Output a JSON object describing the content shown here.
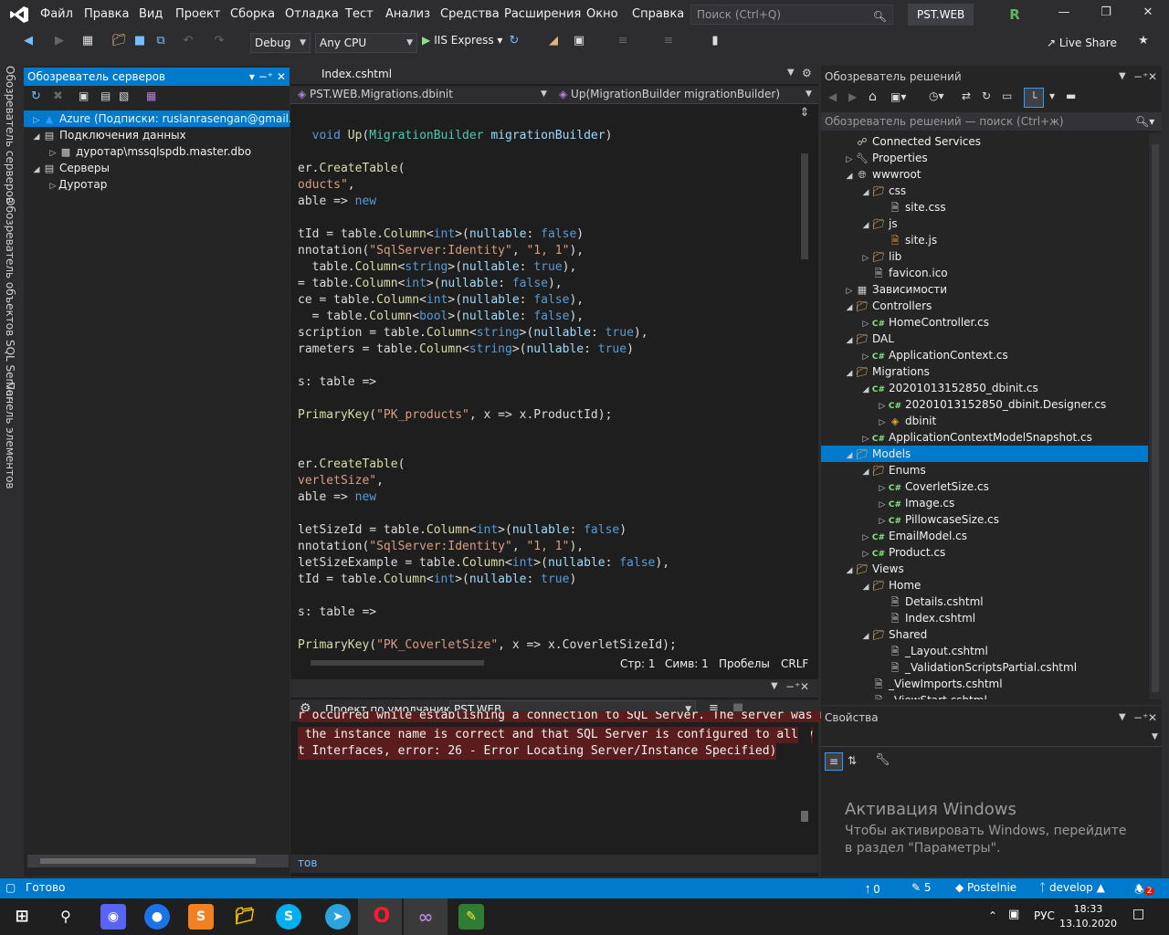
{
  "menu": [
    "Файл",
    "Правка",
    "Вид",
    "Проект",
    "Сборка",
    "Отладка",
    "Тест",
    "Анализ",
    "Средства",
    "Расширения",
    "Окно",
    "Справка"
  ],
  "search_placeholder": "Поиск (Ctrl+Q)",
  "solution_name": "PST.WEB",
  "avatar_letter": "R",
  "toolbar": {
    "config": "Debug",
    "platform": "Any CPU",
    "run_label": "IIS Express",
    "live_share": "Live Share"
  },
  "left_tabs": [
    "Обозреватель серверов",
    "Обозреватель объектов SQL Server",
    "Панель элементов"
  ],
  "server_explorer": {
    "title": "Обозреватель серверов",
    "items": [
      {
        "label": "Azure (Подписки: ruslanrasengan@gmail.com",
        "indent": 0,
        "icon": "azure-icon",
        "exp": "collapsed",
        "selected": true
      },
      {
        "label": "Подключения данных",
        "indent": 0,
        "icon": "database-icon",
        "exp": "expanded"
      },
      {
        "label": "дуротар\\mssqlspdb.master.dbo",
        "indent": 1,
        "icon": "db-connection-icon",
        "exp": "collapsed"
      },
      {
        "label": "Серверы",
        "indent": 0,
        "icon": "server-icon",
        "exp": "expanded"
      },
      {
        "label": "Дуротар",
        "indent": 1,
        "icon": "",
        "exp": "collapsed"
      }
    ]
  },
  "editor": {
    "tab": "Index.cshtml",
    "nav_left": "PST.WEB.Migrations.dbinit",
    "nav_right": "Up(MigrationBuilder migrationBuilder)",
    "status": {
      "line": "Стр: 1",
      "col": "Симв: 1",
      "spaces": "Пробелы",
      "eol": "CRLF"
    }
  },
  "output": {
    "project_label": "Проект по умолчанию:",
    "project": "PST.WEB",
    "errors": [
      "r occurred while establishing a connection to SQL Server. The server was not",
      " the instance name is correct and that SQL Server is configured to allow",
      "t Interfaces, error: 26 - Error Locating Server/Instance Specified)"
    ],
    "bottom_tab": "тов"
  },
  "solution_explorer": {
    "title": "Обозреватель решений",
    "search": "Обозреватель решений — поиск (Ctrl+ж)",
    "items": [
      {
        "label": "Connected Services",
        "indent": 0,
        "icon": "connected-services-icon",
        "exp": "none"
      },
      {
        "label": "Properties",
        "indent": 0,
        "icon": "wrench-icon",
        "exp": "collapsed"
      },
      {
        "label": "wwwroot",
        "indent": 0,
        "icon": "globe-icon",
        "exp": "expanded"
      },
      {
        "label": "css",
        "indent": 1,
        "icon": "folder-icon",
        "exp": "expanded"
      },
      {
        "label": "site.css",
        "indent": 2,
        "icon": "file-icon",
        "exp": "none"
      },
      {
        "label": "js",
        "indent": 1,
        "icon": "folder-icon",
        "exp": "expanded"
      },
      {
        "label": "site.js",
        "indent": 2,
        "icon": "js-file-icon",
        "exp": "none"
      },
      {
        "label": "lib",
        "indent": 1,
        "icon": "folder-icon",
        "exp": "collapsed"
      },
      {
        "label": "favicon.ico",
        "indent": 1,
        "icon": "file-icon",
        "exp": "none"
      },
      {
        "label": "Зависимости",
        "indent": 0,
        "icon": "dependencies-icon",
        "exp": "collapsed"
      },
      {
        "label": "Controllers",
        "indent": 0,
        "icon": "folder-icon",
        "exp": "expanded"
      },
      {
        "label": "HomeController.cs",
        "indent": 1,
        "icon": "csharp-icon",
        "exp": "collapsed"
      },
      {
        "label": "DAL",
        "indent": 0,
        "icon": "folder-icon",
        "exp": "expanded"
      },
      {
        "label": "ApplicationContext.cs",
        "indent": 1,
        "icon": "csharp-icon",
        "exp": "collapsed"
      },
      {
        "label": "Migrations",
        "indent": 0,
        "icon": "folder-icon",
        "exp": "expanded"
      },
      {
        "label": "20201013152850_dbinit.cs",
        "indent": 1,
        "icon": "csharp-icon",
        "exp": "expanded"
      },
      {
        "label": "20201013152850_dbinit.Designer.cs",
        "indent": 2,
        "icon": "csharp-icon",
        "exp": "collapsed"
      },
      {
        "label": "dbinit",
        "indent": 2,
        "icon": "class-icon",
        "exp": "collapsed"
      },
      {
        "label": "ApplicationContextModelSnapshot.cs",
        "indent": 1,
        "icon": "csharp-icon",
        "exp": "collapsed"
      },
      {
        "label": "Models",
        "indent": 0,
        "icon": "folder-icon",
        "exp": "expanded",
        "selected": true
      },
      {
        "label": "Enums",
        "indent": 1,
        "icon": "folder-icon",
        "exp": "expanded"
      },
      {
        "label": "CoverletSize.cs",
        "indent": 2,
        "icon": "csharp-icon",
        "exp": "collapsed"
      },
      {
        "label": "Image.cs",
        "indent": 2,
        "icon": "csharp-icon",
        "exp": "collapsed"
      },
      {
        "label": "PillowcaseSize.cs",
        "indent": 2,
        "icon": "csharp-icon",
        "exp": "collapsed"
      },
      {
        "label": "EmailModel.cs",
        "indent": 1,
        "icon": "csharp-icon",
        "exp": "collapsed"
      },
      {
        "label": "Product.cs",
        "indent": 1,
        "icon": "csharp-icon",
        "exp": "collapsed"
      },
      {
        "label": "Views",
        "indent": 0,
        "icon": "folder-icon",
        "exp": "expanded"
      },
      {
        "label": "Home",
        "indent": 1,
        "icon": "folder-icon",
        "exp": "expanded"
      },
      {
        "label": "Details.cshtml",
        "indent": 2,
        "icon": "file-icon",
        "exp": "none"
      },
      {
        "label": "Index.cshtml",
        "indent": 2,
        "icon": "file-icon",
        "exp": "none"
      },
      {
        "label": "Shared",
        "indent": 1,
        "icon": "folder-icon",
        "exp": "expanded"
      },
      {
        "label": "_Layout.cshtml",
        "indent": 2,
        "icon": "file-icon",
        "exp": "none"
      },
      {
        "label": "_ValidationScriptsPartial.cshtml",
        "indent": 2,
        "icon": "file-icon",
        "exp": "none"
      },
      {
        "label": "_ViewImports.cshtml",
        "indent": 1,
        "icon": "file-icon",
        "exp": "none"
      },
      {
        "label": "_ViewStart.cshtml",
        "indent": 1,
        "icon": "file-icon",
        "exp": "none"
      }
    ]
  },
  "properties": {
    "title": "Свойства",
    "activate_title": "Активация Windows",
    "activate_text": "Чтобы активировать Windows, перейдите в раздел \"Параметры\"."
  },
  "statusbar": {
    "ready": "Готово",
    "up": "0",
    "pencil": "5",
    "repo": "Postelnie",
    "branch": "develop",
    "notif": "2"
  },
  "taskbar": {
    "lang": "РУС",
    "time": "18:33",
    "date": "13.10.2020"
  },
  "colors": {
    "accent": "#007acc",
    "keyword": "#569cd6",
    "type": "#4ec9b0",
    "string": "#d69d85",
    "error_bg": "#5a1d1d"
  }
}
